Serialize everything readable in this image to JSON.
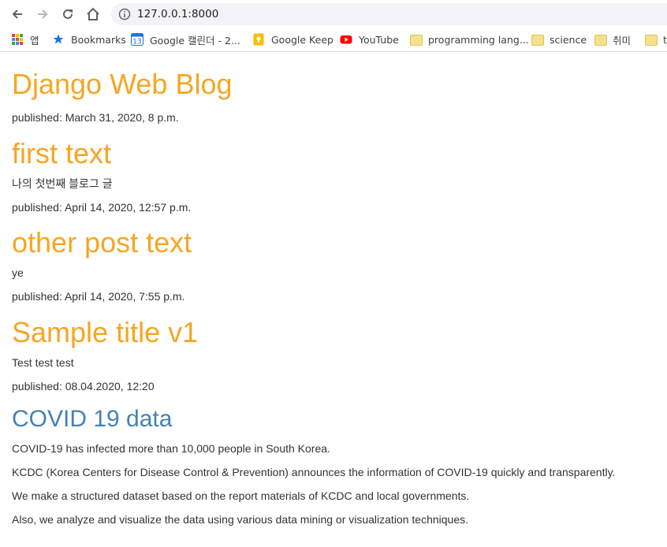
{
  "browser": {
    "url": "127.0.0.1:8000",
    "bookmarks": [
      {
        "label": "앱",
        "icon": "apps-icon"
      },
      {
        "label": "Bookmarks",
        "icon": "star-icon"
      },
      {
        "label": "Google 캘린더 - 2...",
        "icon": "calendar-icon"
      },
      {
        "label": "Google Keep",
        "icon": "keep-icon"
      },
      {
        "label": "YouTube",
        "icon": "youtube-icon"
      },
      {
        "label": "programming lang...",
        "icon": "folder-icon"
      },
      {
        "label": "science",
        "icon": "folder-icon"
      },
      {
        "label": "취미",
        "icon": "folder-icon"
      },
      {
        "label": "t",
        "icon": "folder-icon"
      }
    ],
    "calendar_day": "13"
  },
  "header": {
    "title": "Django Web Blog",
    "published": "published: March 31, 2020, 8 p.m."
  },
  "posts": [
    {
      "title": "first text",
      "text": "나의 첫번째 블로그 글",
      "published": "published: April 14, 2020, 12:57 p.m."
    },
    {
      "title": "other post text",
      "text": "ye",
      "published": "published: April 14, 2020, 7:55 p.m."
    },
    {
      "title": "Sample title v1",
      "text": "Test test test",
      "published": "published: 08.04.2020, 12:20"
    }
  ],
  "covid": {
    "title": "COVID 19 data",
    "lines": [
      "COVID-19 has infected more than 10,000 people in South Korea.",
      "KCDC (Korea Centers for Disease Control & Prevention) announces the information of COVID-19 quickly and transparently.",
      "We make a structured dataset based on the report materials of KCDC and local governments.",
      "Also, we analyze and visualize the data using various data mining or visualization techniques."
    ]
  },
  "colors": {
    "title_orange": "#f5a623",
    "title_blue": "#4682b4",
    "text": "#333333"
  }
}
